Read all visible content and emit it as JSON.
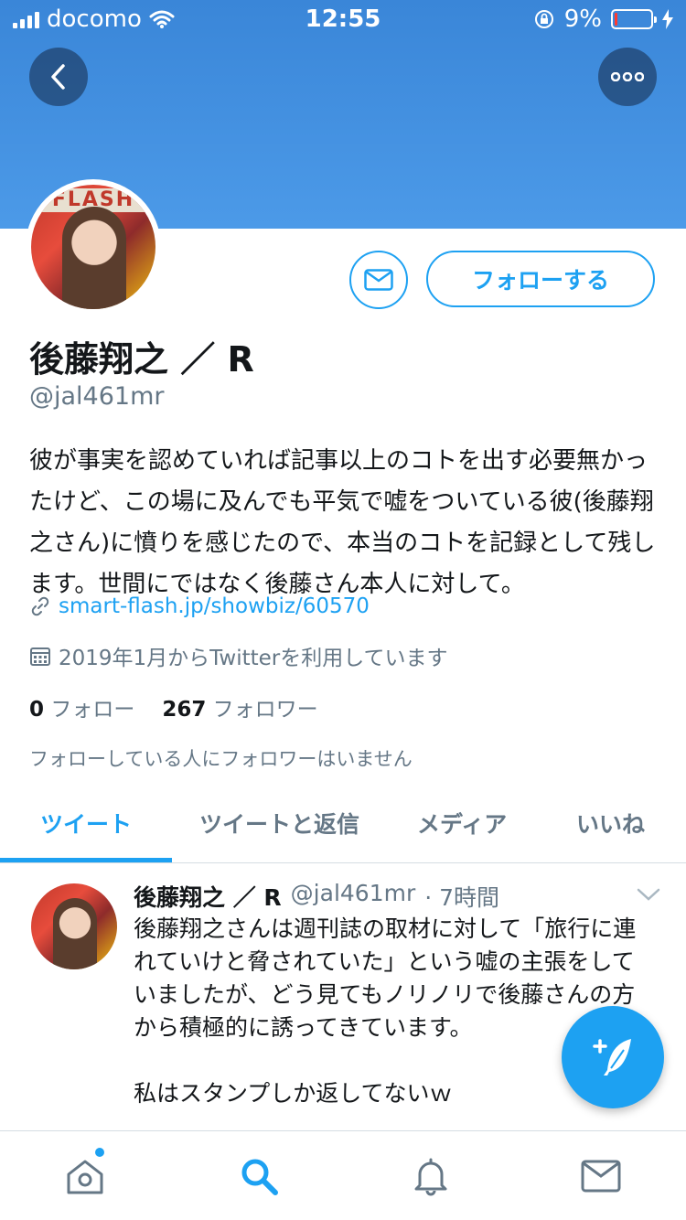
{
  "status_bar": {
    "carrier": "docomo",
    "time": "12:55",
    "battery_percent": "9%",
    "battery_level": 0.09
  },
  "header": {
    "back_icon": "chevron-left-icon",
    "more_icon": "ellipsis-icon"
  },
  "profile": {
    "avatar_caption": "FLASH",
    "message_icon": "envelope-icon",
    "follow_label": "フォローする",
    "name": "後藤翔之 ／ R",
    "handle": "@jal461mr",
    "bio": "彼が事実を認めていれば記事以上のコトを出す必要無かったけど、この場に及んでも平気で嘘をついている彼(後藤翔之さん)に憤りを感じたので、本当のコトを記録として残します。世間にではなく後藤さん本人に対して。",
    "link": "smart-flash.jp/showbiz/60570",
    "joined": "2019年1月からTwitterを利用しています",
    "following_count": "0",
    "following_label": "フォロー",
    "followers_count": "267",
    "followers_label": "フォロワー",
    "followers_note": "フォローしている人にフォロワーはいません"
  },
  "tabs": [
    {
      "label": "ツイート",
      "active": true
    },
    {
      "label": "ツイートと返信",
      "active": false
    },
    {
      "label": "メディア",
      "active": false
    },
    {
      "label": "いいね",
      "active": false
    }
  ],
  "tweet": {
    "name": "後藤翔之 ／ R",
    "handle": "@jal461mr",
    "time": "· 7時間",
    "paragraph1": "後藤翔之さんは週刊誌の取材に対して「旅行に連れていけと脅されていた」という嘘の主張をしていましたが、どう見てもノリノリで後藤さんの方から積極的に誘ってきています。",
    "paragraph2": "私はスタンプしか返してないｗ"
  },
  "compose_icon": "compose-feather-icon",
  "bottom_nav": [
    {
      "name": "home-icon"
    },
    {
      "name": "search-icon"
    },
    {
      "name": "notifications-bell-icon"
    },
    {
      "name": "messages-envelope-icon"
    }
  ],
  "colors": {
    "accent": "#1da1f2",
    "banner": "#4c9ae8",
    "secondary_text": "#657786"
  }
}
